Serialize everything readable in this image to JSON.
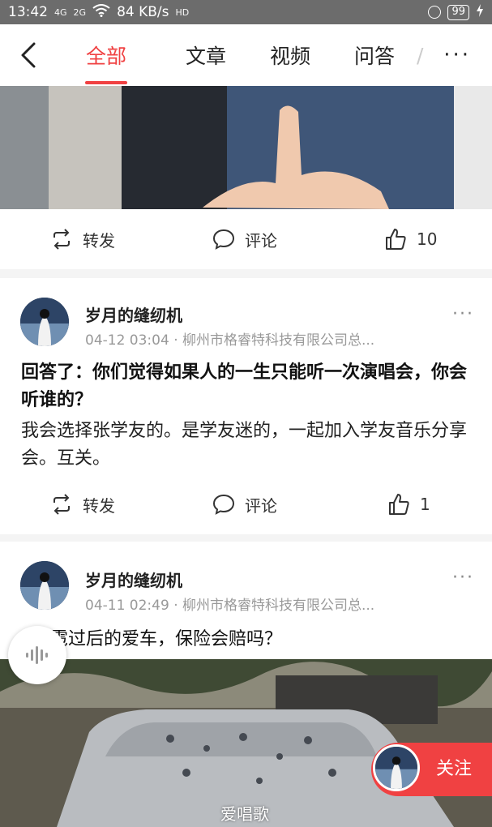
{
  "status_bar": {
    "time": "13:42",
    "signal1": "4G",
    "signal2": "2G",
    "net_speed": "84 KB/s",
    "hd": "HD",
    "battery": "99"
  },
  "nav": {
    "back_icon": "chevron-left-icon",
    "tabs": [
      {
        "label": "全部",
        "active": true
      },
      {
        "label": "文章",
        "active": false
      },
      {
        "label": "视频",
        "active": false
      },
      {
        "label": "问答",
        "active": false
      },
      {
        "label": "/",
        "active": false
      }
    ],
    "more_label": "···"
  },
  "feed": {
    "item1_actions": {
      "repost": "转发",
      "comment": "评论",
      "likes": "10"
    },
    "post2": {
      "user": "岁月的缝纫机",
      "meta": "04-12 03:04 · 柳州市格睿特科技有限公司总...",
      "more": "···",
      "title": "回答了：你们觉得如果人的一生只能听一次演唱会，你会听谁的？",
      "body": "我会选择张学友的。是学友迷的，一起加入学友音乐分享会。互关。",
      "actions": {
        "repost": "转发",
        "comment": "评论",
        "likes": "1"
      }
    },
    "post3": {
      "user": "岁月的缝纫机",
      "meta": "04-11 02:49 · 柳州市格睿特科技有限公司总...",
      "more": "···",
      "title": "雹过后的爱车，保险会赔吗？"
    }
  },
  "floating": {
    "follow_label": "关注",
    "watermark": "爱唱歌"
  },
  "colors": {
    "accent": "#f04142",
    "statusbar": "#6c6c6c"
  }
}
